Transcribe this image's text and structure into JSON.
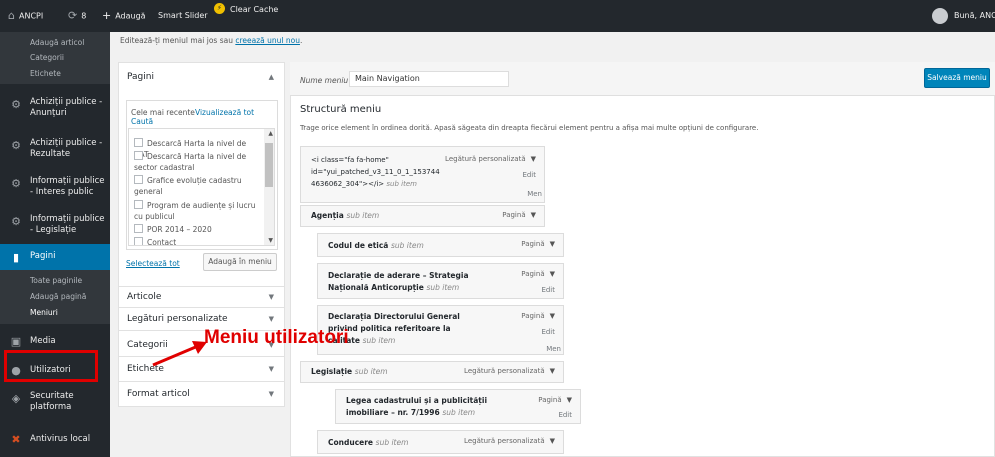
{
  "adminbar": {
    "site_name": "ANCPI",
    "updates_count": "8",
    "new_label": "Adaugă",
    "slider_label": "Smart Slider",
    "clear_cache_label": "Clear Cache",
    "greeting": "Bună, ANCP"
  },
  "sidebar": {
    "posts_sub": [
      "Adaugă articol",
      "Categorii",
      "Etichete"
    ],
    "menu": [
      {
        "label": "Achiziții publice - Anunțuri"
      },
      {
        "label": "Achiziții publice - Rezultate"
      },
      {
        "label": "Informații publice - Interes public"
      },
      {
        "label": "Informații publice - Legislație"
      },
      {
        "label": "Pagini"
      },
      {
        "label": "Media"
      },
      {
        "label": "Utilizatori"
      },
      {
        "label": "Securitate platforma"
      },
      {
        "label": "Antivirus local"
      }
    ],
    "pages_sub": [
      "Toate paginile",
      "Adaugă pagină",
      "Meniuri"
    ]
  },
  "notice": {
    "text": "Editează-ți meniul mai jos sau ",
    "link": "creează unul nou",
    "end": "."
  },
  "left_panel": {
    "pages_title": "Pagini",
    "tab_recent": "Cele mai recente",
    "tab_all": "Vizualizează tot",
    "tab_search": "Caută",
    "items": [
      "Descarcă Harta la nivel de UAT",
      "Descarcă Harta la nivel de sector cadastral",
      "Grafice evoluție cadastru general",
      "Program de audiențe și lucru cu publicul",
      "POR 2014 – 2020",
      "Contact"
    ],
    "select_all": "Selectează tot",
    "add_to_menu": "Adaugă în meniu",
    "sections": [
      "Articole",
      "Legături personalizate",
      "Categorii",
      "Etichete",
      "Format articol"
    ]
  },
  "menu_editor": {
    "name_label": "Nume meniu",
    "name_value": "Main Navigation",
    "save_label": "Salvează meniu",
    "structure_title": "Structură meniu",
    "structure_desc": "Trage orice element în ordinea dorită. Apasă săgeata din dreapta fiecărui element pentru a afișa mai multe opțiuni de configurare.",
    "sub_item_label": "sub item",
    "items": [
      {
        "title": "<i class=\"fa fa-home\" id=\"yui_patched_v3_11_0_1_153744 4636062_304\"></i>",
        "type": "Legătură personalizată",
        "edit": "Edit",
        "extra": "Men"
      },
      {
        "title": "Agenția",
        "type": "Pagină"
      },
      {
        "title": "Codul de etică",
        "type": "Pagină"
      },
      {
        "title": "Declarație de aderare – Strategia Națională Anticorupție",
        "type": "Pagină",
        "edit": "Edit"
      },
      {
        "title": "Declarația Directorului General privind politica referitoare la calitate",
        "type": "Pagină",
        "edit": "Edit",
        "extra": "Men"
      },
      {
        "title": "Legislație",
        "type": "Legătură personalizată"
      },
      {
        "title": "Legea cadastrului și a publicității imobiliare – nr. 7/1996",
        "type": "Pagină",
        "edit": "Edit"
      },
      {
        "title": "Conducere",
        "type": "Legătură personalizată"
      }
    ]
  },
  "annotation": {
    "text": "Meniu utilizatori"
  }
}
